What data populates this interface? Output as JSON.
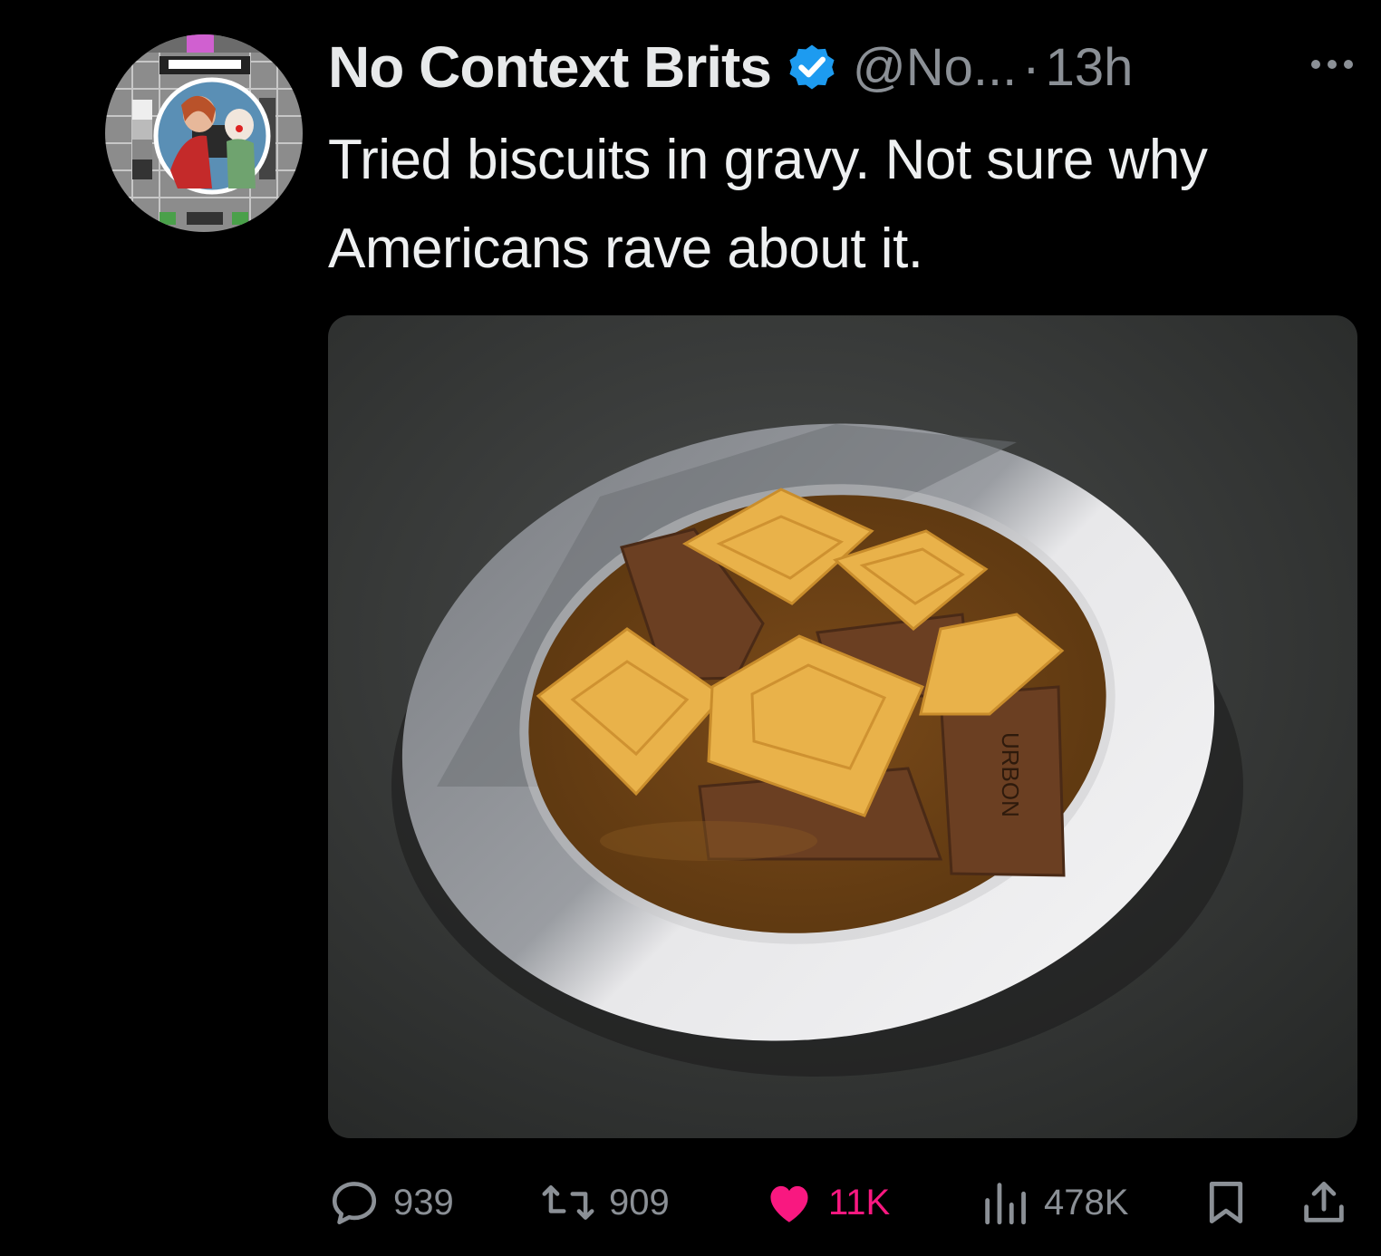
{
  "tweet": {
    "display_name": "No Context Brits",
    "verified_icon": "verified-badge-icon",
    "handle": "@No...",
    "separator": "·",
    "time": "13h",
    "text": "Tried biscuits in gravy. Not sure why Americans rave about it.",
    "media_icon": "photo-of-biscuits-in-gravy",
    "biscuit_stamp": "URBON"
  },
  "actions": {
    "reply": {
      "icon": "reply-icon",
      "count": "939"
    },
    "retweet": {
      "icon": "retweet-icon",
      "count": "909"
    },
    "like": {
      "icon": "heart-icon",
      "count": "11K",
      "liked": true
    },
    "views": {
      "icon": "views-icon",
      "count": "478K"
    },
    "bookmark": {
      "icon": "bookmark-icon"
    },
    "share": {
      "icon": "share-icon"
    }
  },
  "colors": {
    "background": "#000000",
    "text": "#e7e9ea",
    "muted": "#8b9096",
    "verified": "#1d9bf0",
    "like": "#f91880"
  }
}
